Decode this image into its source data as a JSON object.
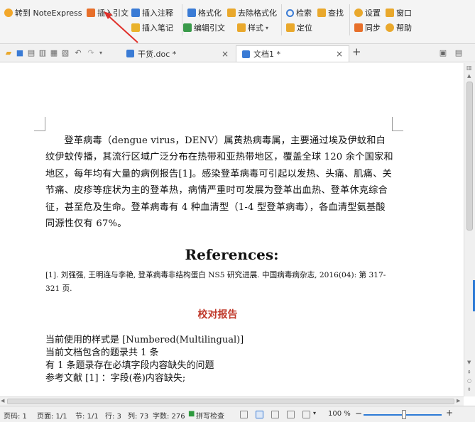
{
  "ribbon": {
    "goto_notexpress": "转到 NoteExpress",
    "insert_citation": "插入引文",
    "insert_note": "插入注释",
    "insert_bibnote": "插入笔记",
    "format": "格式化",
    "remove_format": "去除格式化",
    "edit_citation": "编辑引文",
    "style": "样式",
    "search": "检索",
    "find": "查找",
    "locate": "定位",
    "settings": "设置",
    "window": "窗口",
    "sync": "同步",
    "help": "帮助"
  },
  "tabs": [
    {
      "label": "干货.doc *"
    },
    {
      "label": "文档1 *"
    }
  ],
  "document": {
    "paragraph": "登革病毒（dengue virus，DENV）属黄热病毒属，主要通过埃及伊蚊和白纹伊蚊传播，其流行区域广泛分布在热带和亚热带地区，覆盖全球 120 余个国家和地区，每年均有大量的病例报告[1]。感染登革病毒可引起以发热、头痛、肌痛、关节痛、皮疹等症状为主的登革热，病情严重时可发展为登革出血热、登革休克综合征，甚至危及生命。登革病毒有 4 种血清型（1-4 型登革病毒），各血清型氨基酸同源性仅有 67%。",
    "references_title": "References:",
    "reference_1": "[1].  刘强强, 王明连与李艳, 登革病毒非结构蛋白 NS5 研究进展. 中国病毒病杂志, 2016(04): 第 317-321 页.",
    "report_title": "校对报告",
    "report_lines": [
      "当前使用的样式是 [Numbered(Multilingual)]",
      "当前文档包含的题录共 1 条",
      "有 1 条题录存在必填字段内容缺失的问题",
      "参考文献  [1] ：字段(卷)内容缺失;"
    ]
  },
  "status": {
    "page": "页码: 1",
    "pages": "页面: 1/1",
    "section": "节: 1/1",
    "row": "行: 3",
    "col": "列: 73",
    "wordcount": "字数: 276",
    "spellcheck": "拼写检查",
    "zoom": "100 %"
  },
  "colors": {
    "accent_blue": "#2d7bd6",
    "annotation_red": "#e0302a",
    "report_title_red": "#c0392b"
  }
}
